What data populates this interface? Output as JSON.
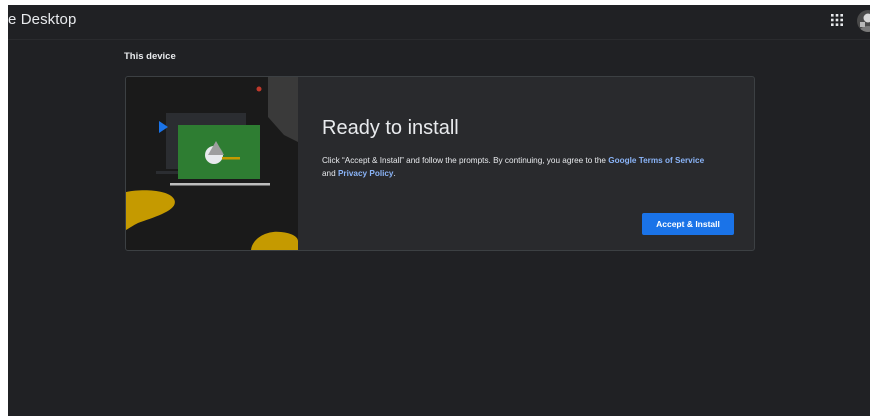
{
  "header": {
    "title": "e Desktop"
  },
  "section": {
    "label": "This device"
  },
  "card": {
    "title": "Ready to install",
    "body_prefix": "Click “Accept & Install” and follow the prompts. By continuing, you agree to the",
    "terms_link": "Google Terms of Service",
    "body_middle": "and",
    "privacy_link": "Privacy Policy",
    "body_suffix": ".",
    "install_button": "Accept & Install"
  },
  "colors": {
    "background": "#202124",
    "card": "#292a2d",
    "accent_blue": "#1a73e8",
    "link_blue": "#8ab4f8",
    "illustration_green": "#2e7d32",
    "illustration_yellow": "#c59a00"
  },
  "icons": {
    "apps": "apps-grid-icon",
    "avatar": "user-avatar"
  }
}
